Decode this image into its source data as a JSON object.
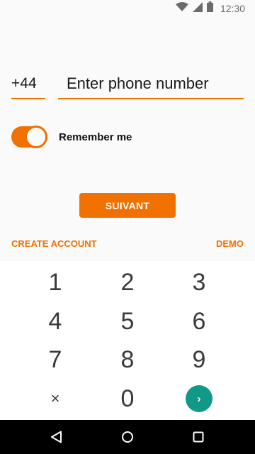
{
  "status_bar": {
    "time": "12:30",
    "icons": [
      "wifi-icon",
      "cell-signal-icon",
      "battery-icon"
    ]
  },
  "login": {
    "country_code": "+44",
    "phone_placeholder": "Enter phone number",
    "remember_label": "Remember me",
    "remember_on": true,
    "submit_label": "SUIVANT",
    "create_account_label": "CREATE ACCOUNT",
    "demo_label": "DEMO"
  },
  "keypad": {
    "keys": [
      "1",
      "2",
      "3",
      "4",
      "5",
      "6",
      "7",
      "8",
      "9",
      "×",
      "0",
      "›"
    ]
  },
  "nav_bar": {
    "icons": [
      "back-icon",
      "home-icon",
      "recent-apps-icon"
    ]
  },
  "colors": {
    "accent": "#f07000",
    "keypad_go": "#119988",
    "nav_bar": "#000000"
  }
}
